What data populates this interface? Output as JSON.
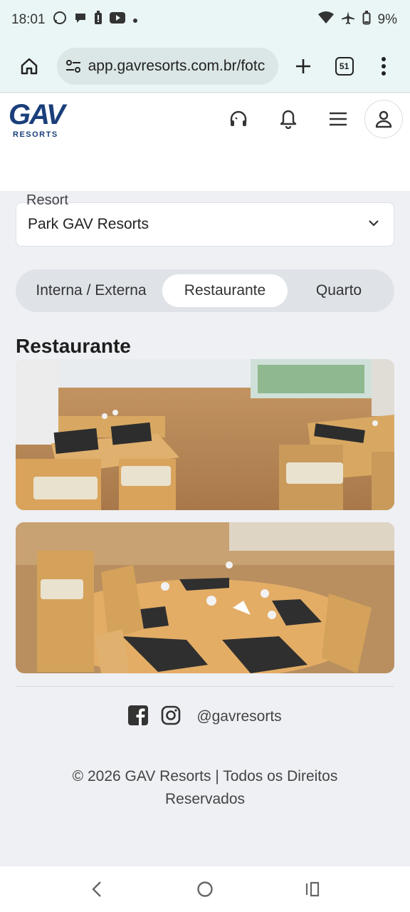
{
  "status_bar": {
    "time": "18:01",
    "battery": "9%"
  },
  "browser": {
    "url": "app.gavresorts.com.br/fotc",
    "tab_count": "51"
  },
  "header": {
    "logo_main": "GAV",
    "logo_sub": "RESORTS"
  },
  "resort_select": {
    "label": "Resort",
    "value": "Park GAV Resorts"
  },
  "tabs": [
    {
      "label": "Interna / Externa",
      "active": false
    },
    {
      "label": "Restaurante",
      "active": true
    },
    {
      "label": "Quarto",
      "active": false
    }
  ],
  "section": {
    "title": "Restaurante"
  },
  "footer": {
    "handle": "@gavresorts",
    "copyright": "© 2026 GAV Resorts | Todos os Direitos Reservados"
  },
  "colors": {
    "brand": "#1a3f7a",
    "page_bg": "#eef0f4",
    "chrome_bg": "#eaf5f5"
  }
}
